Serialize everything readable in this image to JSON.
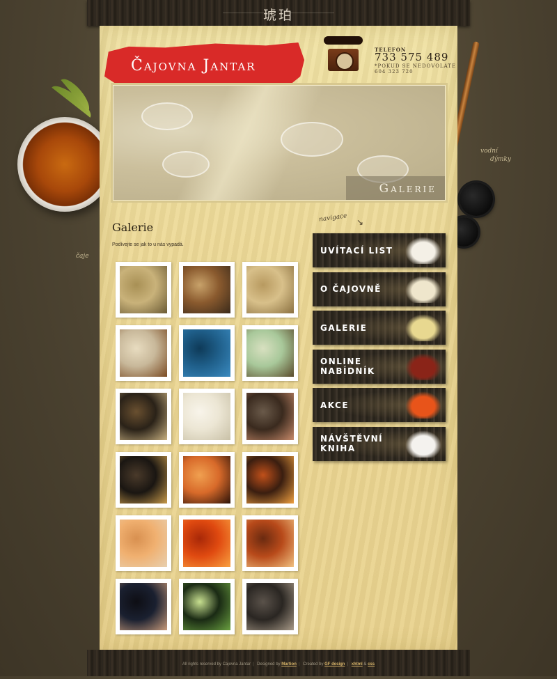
{
  "top_bar": {
    "glyphs": "琥珀"
  },
  "side": {
    "left_label": "čaje",
    "right_label_1": "vodní",
    "right_label_2": "dýmky"
  },
  "header": {
    "logo": "Čajovna Jantar",
    "phone_label": "TELEFON",
    "phone_number": "733 575 489",
    "phone_note_1": "*POKUD SE NEDOVOLÁTE",
    "phone_note_2": "604 323 720",
    "banner_caption": "Galerie"
  },
  "content": {
    "title": "Galerie",
    "intro": "Podívejte se jak to u nás vypadá.",
    "photos": [
      {
        "colors": [
          "#c9b27a",
          "#6a5a34",
          "#a89055"
        ]
      },
      {
        "colors": [
          "#8a5a2e",
          "#3a2a1a",
          "#c8a26a"
        ]
      },
      {
        "colors": [
          "#d8c08a",
          "#8a7040",
          "#b89a60"
        ]
      },
      {
        "colors": [
          "#c8b89a",
          "#7a4a22",
          "#e8dcc0"
        ]
      },
      {
        "colors": [
          "#1f5f8a",
          "#3a8ac0",
          "#0e3a58"
        ]
      },
      {
        "colors": [
          "#a8c89a",
          "#5a4a2a",
          "#d8e0c0"
        ]
      },
      {
        "colors": [
          "#2a2218",
          "#c8b080",
          "#6a5030"
        ]
      },
      {
        "colors": [
          "#ece6d4",
          "#c8c0a6",
          "#f8f4ea"
        ]
      },
      {
        "colors": [
          "#3a2a1e",
          "#c88a6a",
          "#6a5a4a"
        ]
      },
      {
        "colors": [
          "#1a1612",
          "#c89a4a",
          "#4a3a2a"
        ]
      },
      {
        "colors": [
          "#d86a2a",
          "#2a1208",
          "#f0a050"
        ]
      },
      {
        "colors": [
          "#3a1e10",
          "#f0a040",
          "#c0501a"
        ]
      },
      {
        "colors": [
          "#f0b070",
          "#e8d0b0",
          "#d89050"
        ]
      },
      {
        "colors": [
          "#e04a10",
          "#f8a040",
          "#a82808"
        ]
      },
      {
        "colors": [
          "#b84a1a",
          "#f0c080",
          "#6a2a10"
        ]
      },
      {
        "colors": [
          "#1a2030",
          "#c89a7a",
          "#0e0e14"
        ]
      },
      {
        "colors": [
          "#1a2a14",
          "#6aa040",
          "#c8e090"
        ]
      },
      {
        "colors": [
          "#2a2622",
          "#a89a88",
          "#5a524a"
        ]
      }
    ]
  },
  "navigation": {
    "label": "navigace",
    "items": [
      {
        "label": "UVÍTACÍ LIST",
        "icon": "teacup-icon",
        "picture": "#f4f0e6"
      },
      {
        "label": "O ČAJOVNĚ",
        "icon": "book-icon",
        "picture": "#efe6cc"
      },
      {
        "label": "GALERIE",
        "icon": "picture-frame-icon",
        "picture": "#e8d890"
      },
      {
        "label": "ONLINE NABÍDNÍK",
        "icon": "menu-card-icon",
        "picture": "#8a2418"
      },
      {
        "label": "AKCE",
        "icon": "cushion-icon",
        "picture": "#e8541a"
      },
      {
        "label": "NÁVŠTĚVNÍ KNIHA",
        "icon": "note-icon",
        "picture": "#f4f2ee"
      }
    ]
  },
  "footer": {
    "rights": "All rights reserved by Cajovna Jantar",
    "designed_by": "Designed by",
    "designer": "Martion",
    "created_by": "Created by",
    "creator": "GF design",
    "tech_1": "xhtml",
    "and": "&",
    "tech_2": "css"
  }
}
